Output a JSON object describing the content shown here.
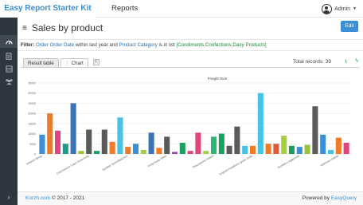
{
  "app": {
    "brand": "Easy Report Starter Kit",
    "nav_reports": "Reports",
    "user": "Admin"
  },
  "page": {
    "title": "Sales by product",
    "edit_label": "Edit"
  },
  "filter": {
    "label": "Filter:",
    "attr1": "Order Order Date",
    "op1": "within last year",
    "joiner": "and",
    "attr2": "Product Category",
    "op2": "is in list",
    "values": "[Condiments,Confections,Dairy Products]"
  },
  "tabs": [
    {
      "label": "Result table"
    },
    {
      "label": "Chart"
    }
  ],
  "tab_add": "+",
  "records": "Total records: 39",
  "footer": {
    "brand": "Korzh.com",
    "copyright": "© 2017 - 2021",
    "powered": "Powered by",
    "powered_link": "EasyQuery"
  },
  "colors": {
    "accent": "#3b8fd6",
    "sidebar": "#2e3640",
    "green": "#1a8a3a"
  },
  "icons": {
    "user": "user-circle-icon",
    "menu": "hamburger-icon",
    "sidebar": [
      "dashboard-icon",
      "reports-icon",
      "data-icon",
      "users-icon"
    ],
    "collapse": "chevron-right-icon",
    "export": "export-icon",
    "refresh": "lightning-icon"
  },
  "chart_data": {
    "type": "bar",
    "title": "Freight Sum",
    "ylim": [
      0,
      35000
    ],
    "yticks": [
      0,
      5000,
      10000,
      15000,
      20000,
      25000,
      30000,
      35000
    ],
    "xtick_labels": [
      "Aniseed Syrup",
      "Chef Anton's Cajun Seasoning",
      "Gumbär Gummibärchen",
      "Gorgonzola Telino",
      "Mascarpone Fabioli",
      "Original Frankfurter grüne Soße",
      "Scottish Longbreads",
      "Valkoinen suklaa"
    ],
    "values": [
      9500,
      20000,
      11500,
      5000,
      25000,
      1500,
      12000,
      1500,
      12000,
      6000,
      18000,
      3500,
      5000,
      2000,
      10500,
      3000,
      8500,
      1000,
      5500,
      1500,
      10500,
      1500,
      8500,
      10000,
      4000,
      13500,
      4000,
      4000,
      30000,
      5000,
      5000,
      9000,
      4000,
      3500,
      4500,
      23500,
      9500,
      2000,
      8000,
      5500
    ],
    "colors": [
      "#3c8fd6",
      "#ef7a28",
      "#e0457b",
      "#1b9b8e",
      "#3a74b7",
      "#9bc23c",
      "#5a5a5a",
      "#18a05d",
      "#5a5a5a",
      "#ef7a28",
      "#47c3e6",
      "#ef7a28",
      "#3c8fd6",
      "#a6cf3c",
      "#3a74b7",
      "#ef7a28",
      "#5a5a5a",
      "#8e44ad",
      "#18a05d",
      "#e0457b",
      "#e0457b",
      "#a6cf3c",
      "#2bb673",
      "#18a05d",
      "#5a5a5a",
      "#5a5a5a",
      "#47c3e6",
      "#ef7a28",
      "#47c3e6",
      "#ef7a28",
      "#e05a3a",
      "#a6cf3c",
      "#18a05d",
      "#3c8fd6",
      "#9bc23c",
      "#5a5a5a",
      "#3c8fd6",
      "#47c3e6",
      "#ef7a28",
      "#e0457b"
    ]
  }
}
